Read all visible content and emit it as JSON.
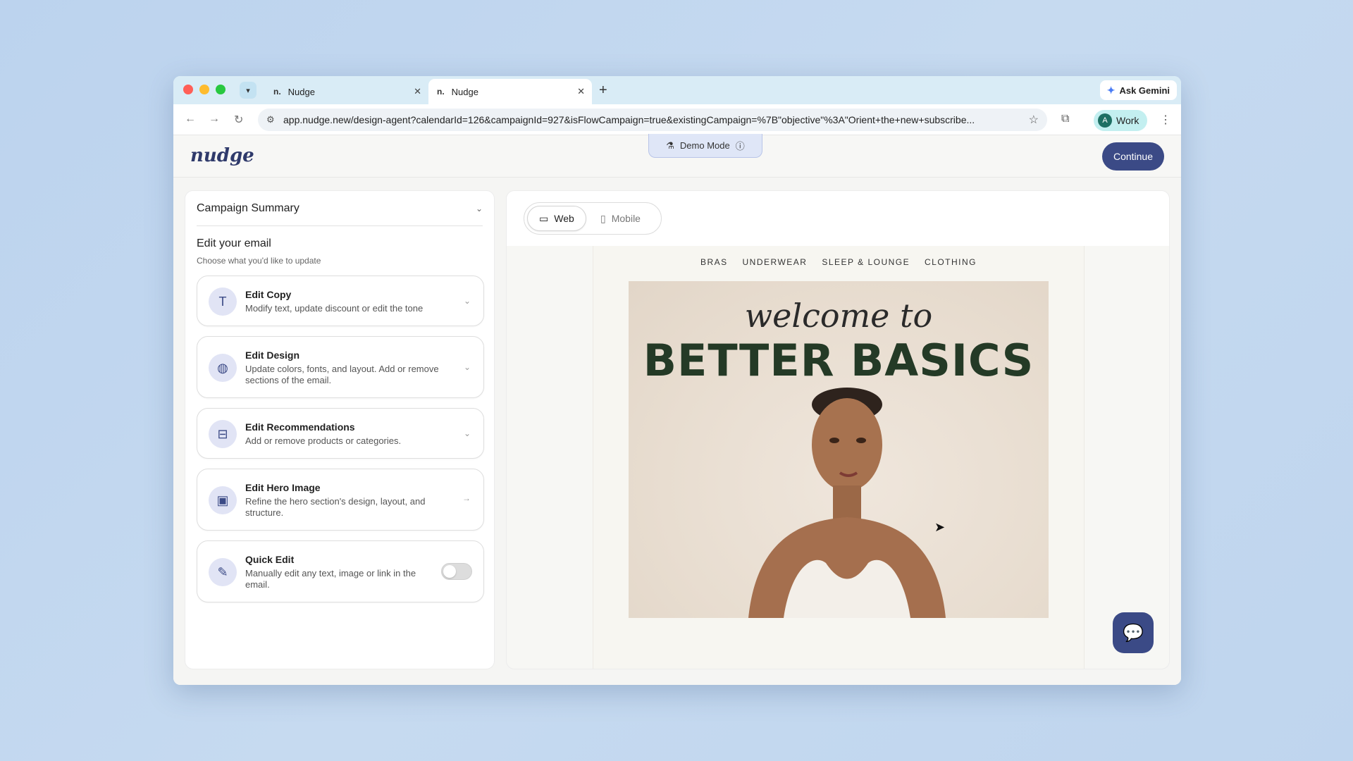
{
  "browser": {
    "tabs": [
      {
        "favicon": "n.",
        "title": "Nudge"
      },
      {
        "favicon": "n.",
        "title": "Nudge"
      }
    ],
    "new_tab": "+",
    "gemini_label": "Ask Gemini",
    "url": "app.nudge.new/design-agent?calendarId=126&campaignId=927&isFlowCampaign=true&existingCampaign=%7B\"objective\"%3A\"Orient+the+new+subscribe...",
    "profile_initial": "A",
    "profile_label": "Work"
  },
  "app": {
    "logo": "nudge",
    "demo_mode": "Demo Mode",
    "continue_label": "Continue"
  },
  "left_panel": {
    "summary_title": "Campaign Summary",
    "edit_title": "Edit your email",
    "edit_subtitle": "Choose what you'd like to update",
    "cards": [
      {
        "title": "Edit Copy",
        "desc": "Modify text, update discount or edit the tone",
        "icon": "text-icon"
      },
      {
        "title": "Edit Design",
        "desc": "Update colors, fonts, and layout. Add or remove sections of the email.",
        "icon": "palette-icon"
      },
      {
        "title": "Edit Recommendations",
        "desc": "Add or remove products or categories.",
        "icon": "grid-icon"
      },
      {
        "title": "Edit Hero Image",
        "desc": "Refine the hero section's design, layout, and structure.",
        "icon": "image-icon"
      },
      {
        "title": "Quick Edit",
        "desc": "Manually edit any text, image or link in the email.",
        "icon": "pencil-icon"
      }
    ],
    "quick_edit_enabled": false
  },
  "preview": {
    "view_options": [
      "Web",
      "Mobile"
    ],
    "selected_view": "Web",
    "email_nav": [
      "BRAS",
      "UNDERWEAR",
      "SLEEP & LOUNGE",
      "CLOTHING"
    ],
    "hero_line1": "welcome to",
    "hero_line2": "BETTER BASICS"
  },
  "colors": {
    "accent": "#3b4a86",
    "hero_text": "#243a26"
  }
}
